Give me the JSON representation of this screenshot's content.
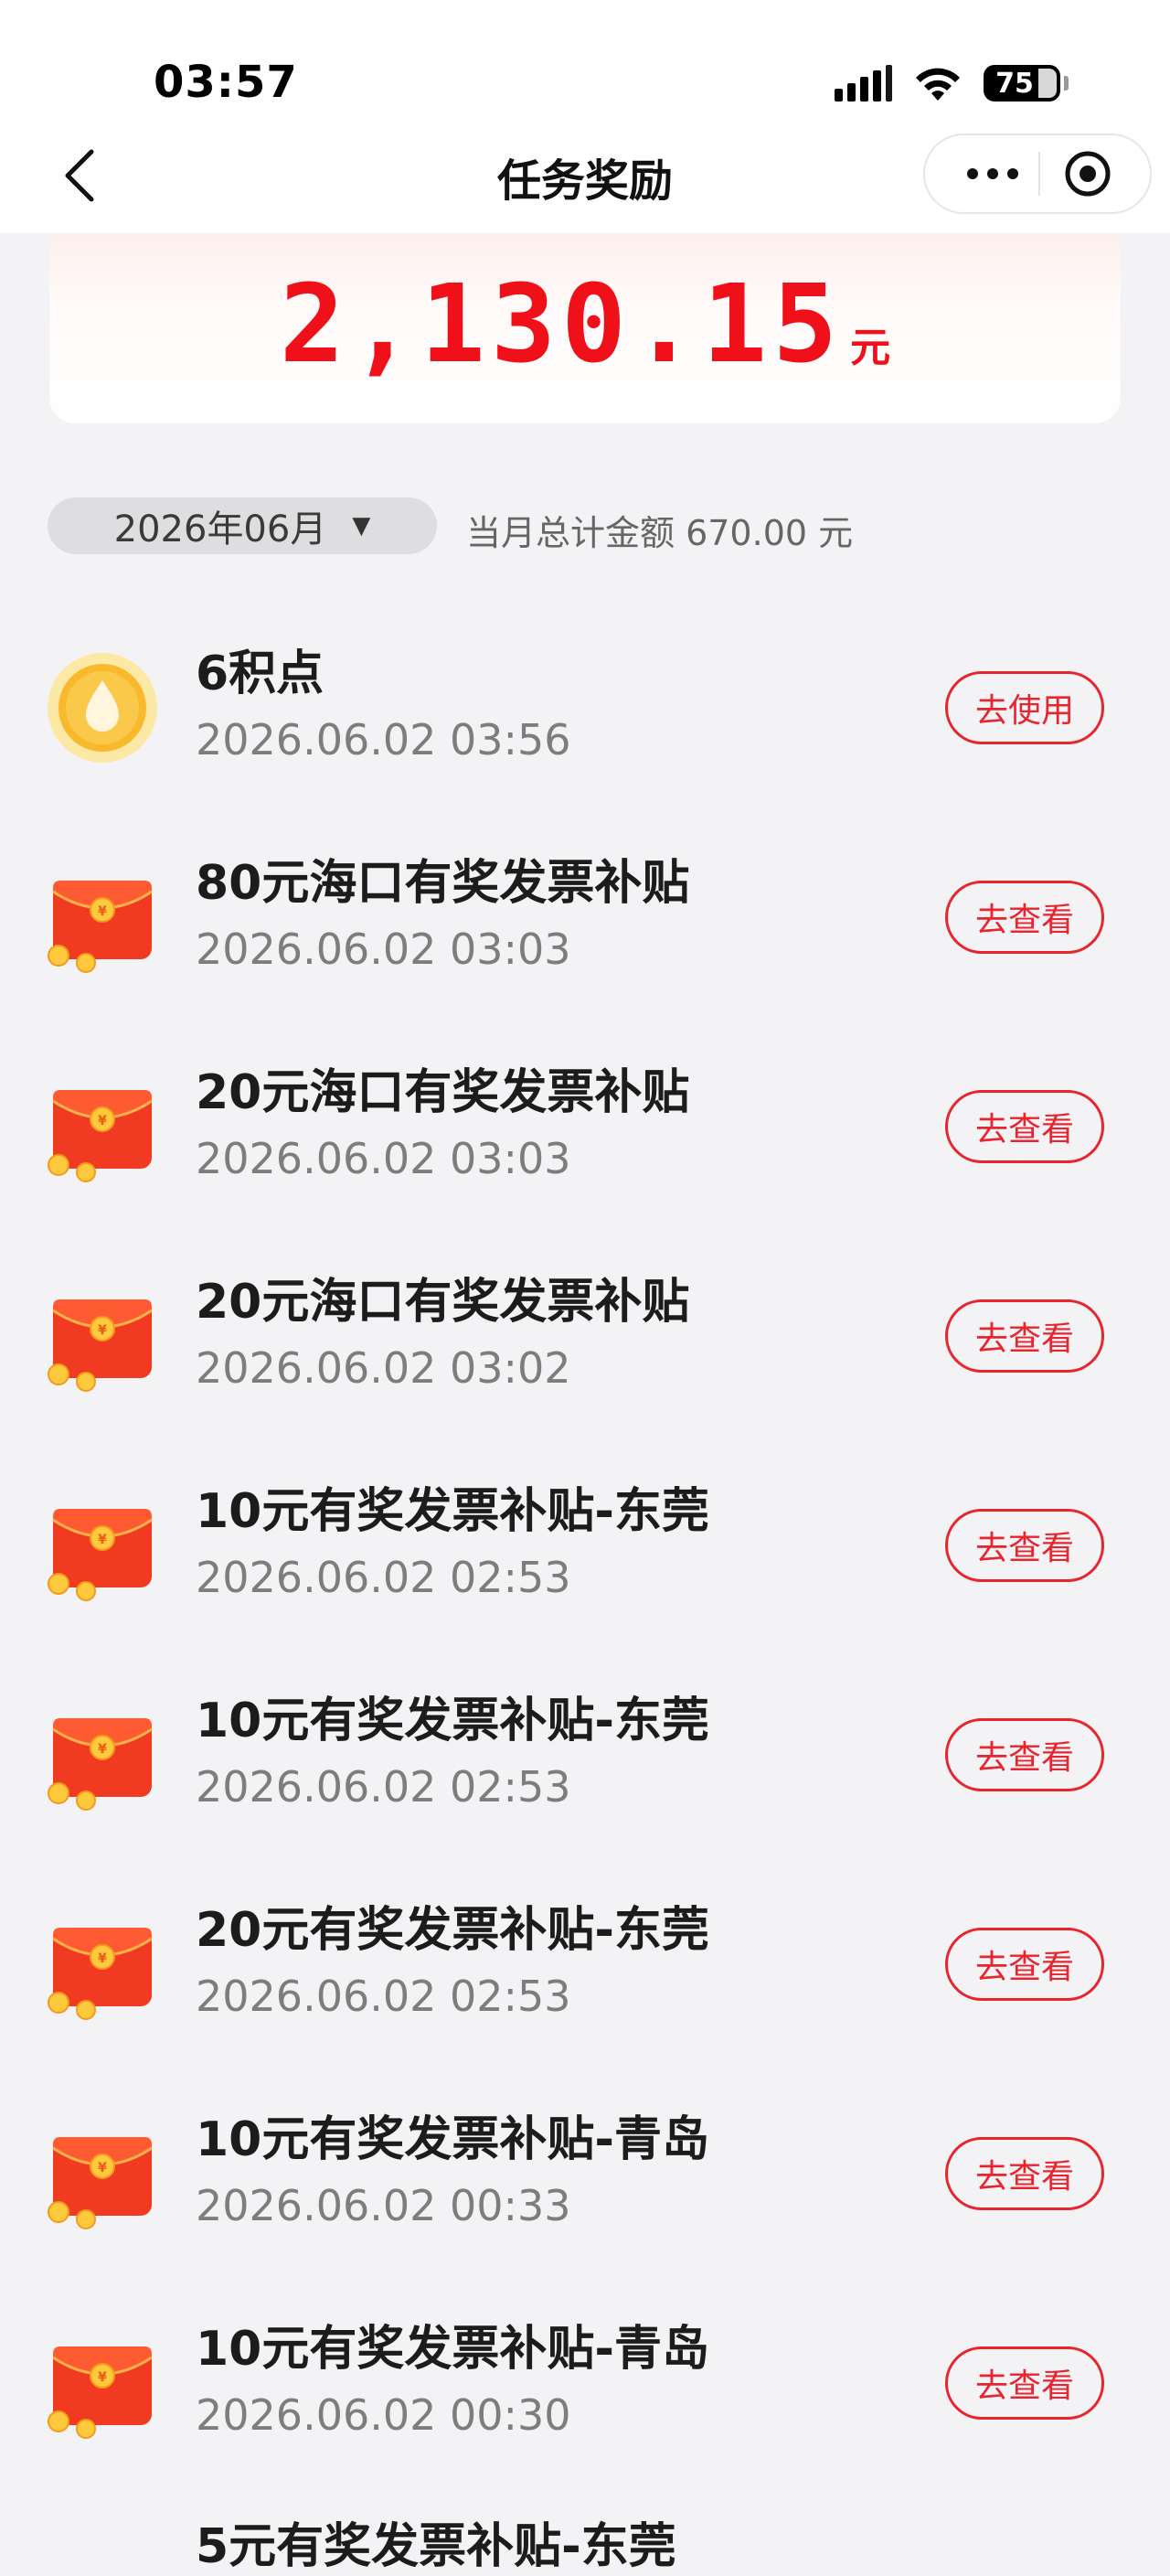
{
  "status": {
    "time": "03:57",
    "battery": "75"
  },
  "header": {
    "title": "任务奖励"
  },
  "summary": {
    "amount": "2,130.15",
    "unit": "元"
  },
  "filter": {
    "month": "2026年06月",
    "monthly_total": "当月总计金额 670.00 元"
  },
  "rewards": [
    {
      "icon": "coin-drop-icon",
      "title": "6积点",
      "time": "2026.06.02 03:56",
      "action": "去使用"
    },
    {
      "icon": "red-envelope-icon",
      "title": "80元海口有奖发票补贴",
      "time": "2026.06.02 03:03",
      "action": "去查看"
    },
    {
      "icon": "red-envelope-icon",
      "title": "20元海口有奖发票补贴",
      "time": "2026.06.02 03:03",
      "action": "去查看"
    },
    {
      "icon": "red-envelope-icon",
      "title": "20元海口有奖发票补贴",
      "time": "2026.06.02 03:02",
      "action": "去查看"
    },
    {
      "icon": "red-envelope-icon",
      "title": "10元有奖发票补贴-东莞",
      "time": "2026.06.02 02:53",
      "action": "去查看"
    },
    {
      "icon": "red-envelope-icon",
      "title": "10元有奖发票补贴-东莞",
      "time": "2026.06.02 02:53",
      "action": "去查看"
    },
    {
      "icon": "red-envelope-icon",
      "title": "20元有奖发票补贴-东莞",
      "time": "2026.06.02 02:53",
      "action": "去查看"
    },
    {
      "icon": "red-envelope-icon",
      "title": "10元有奖发票补贴-青岛",
      "time": "2026.06.02 00:33",
      "action": "去查看"
    },
    {
      "icon": "red-envelope-icon",
      "title": "10元有奖发票补贴-青岛",
      "time": "2026.06.02 00:30",
      "action": "去查看"
    }
  ],
  "partial_row": {
    "title": "5元有奖发票补贴-东莞"
  },
  "colors": {
    "accent": "#e8242f",
    "amount": "#f0101a",
    "background": "#f3f3f5"
  }
}
